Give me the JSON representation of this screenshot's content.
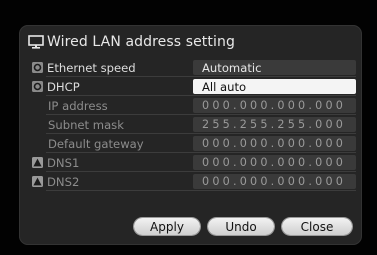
{
  "window": {
    "title": "Wired LAN address setting"
  },
  "settings": [
    {
      "label": "Ethernet speed",
      "value": "Automatic",
      "badge": "o-badge-icon",
      "state": "normal"
    },
    {
      "label": "DHCP",
      "value": "All auto",
      "badge": "o-badge-icon",
      "state": "selected"
    },
    {
      "label": "IP address",
      "value": "000.000.000.000",
      "badge": "",
      "state": "disabled"
    },
    {
      "label": "Subnet mask",
      "value": "255.255.255.000",
      "badge": "",
      "state": "disabled"
    },
    {
      "label": "Default gateway",
      "value": "000.000.000.000",
      "badge": "",
      "state": "disabled"
    },
    {
      "label": "DNS1",
      "value": "000.000.000.000",
      "badge": "warning-triangle-icon",
      "state": "normal"
    },
    {
      "label": "DNS2",
      "value": "000.000.000.000",
      "badge": "warning-triangle-icon",
      "state": "normal"
    }
  ],
  "buttons": {
    "apply": "Apply",
    "undo": "Undo",
    "close": "Close"
  },
  "colors": {
    "panel": "#252525",
    "selected_field": "#f4f4f4",
    "button_face": "#e6e6e6"
  }
}
